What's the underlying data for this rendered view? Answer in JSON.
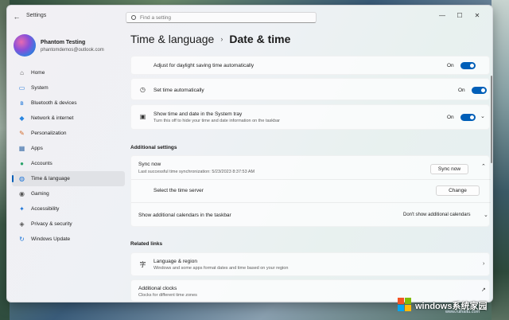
{
  "window": {
    "app_title": "Settings",
    "controls": {
      "minimize": "—",
      "maximize": "☐",
      "close": "✕"
    }
  },
  "search": {
    "placeholder": "Find a setting"
  },
  "profile": {
    "name": "Phantom Testing",
    "email": "phantomdemos@outlook.com"
  },
  "sidebar": {
    "items": [
      {
        "label": "Home",
        "icon": "home-icon",
        "glyph": "⌂",
        "color": "#555555"
      },
      {
        "label": "System",
        "icon": "system-icon",
        "glyph": "▭",
        "color": "#1a73d8"
      },
      {
        "label": "Bluetooth & devices",
        "icon": "bluetooth-icon",
        "glyph": "ʙ",
        "color": "#1a73d8"
      },
      {
        "label": "Network & internet",
        "icon": "network-icon",
        "glyph": "◆",
        "color": "#2a86e0"
      },
      {
        "label": "Personalization",
        "icon": "personalization-icon",
        "glyph": "✎",
        "color": "#d26a2a"
      },
      {
        "label": "Apps",
        "icon": "apps-icon",
        "glyph": "▦",
        "color": "#3b6ea8"
      },
      {
        "label": "Accounts",
        "icon": "accounts-icon",
        "glyph": "●",
        "color": "#2aa36a"
      },
      {
        "label": "Time & language",
        "icon": "globe-clock-icon",
        "glyph": "◍",
        "color": "#1a73d8",
        "active": true
      },
      {
        "label": "Gaming",
        "icon": "gaming-icon",
        "glyph": "◉",
        "color": "#555555"
      },
      {
        "label": "Accessibility",
        "icon": "accessibility-icon",
        "glyph": "✦",
        "color": "#1a73d8"
      },
      {
        "label": "Privacy & security",
        "icon": "shield-icon",
        "glyph": "◈",
        "color": "#555555"
      },
      {
        "label": "Windows Update",
        "icon": "update-icon",
        "glyph": "↻",
        "color": "#1a73d8"
      }
    ]
  },
  "breadcrumb": {
    "parent": "Time & language",
    "separator": "›",
    "current": "Date & time"
  },
  "main": {
    "dst": {
      "title": "Adjust for daylight saving time automatically",
      "state": "On"
    },
    "set_time": {
      "title": "Set time automatically",
      "state": "On",
      "icon": "clock-icon"
    },
    "systray": {
      "title": "Show time and date in the System tray",
      "subtitle": "Turn this off to hide your time and date information on the taskbar",
      "state": "On",
      "icon": "calendar-clock-icon"
    },
    "additional_settings": {
      "header": "Additional settings",
      "sync": {
        "title": "Sync now",
        "subtitle": "Last successful time synchronization: 5/23/2023 8:37:53 AM",
        "button": "Sync now"
      },
      "time_server": {
        "title": "Select the time server",
        "button": "Change"
      },
      "calendars": {
        "title": "Show additional calendars in the taskbar",
        "value": "Don't show additional calendars"
      }
    },
    "related_links": {
      "header": "Related links",
      "language_region": {
        "title": "Language & region",
        "subtitle": "Windows and some apps format dates and time based on your region",
        "icon": "language-icon"
      },
      "additional_clocks": {
        "title": "Additional clocks",
        "subtitle": "Clocks for different time zones"
      }
    }
  },
  "watermark": {
    "text": "windows系统家园",
    "url": "www.ruihaitu.com"
  },
  "colors": {
    "accent": "#005fb8",
    "toggle_on": "#005fb8"
  }
}
